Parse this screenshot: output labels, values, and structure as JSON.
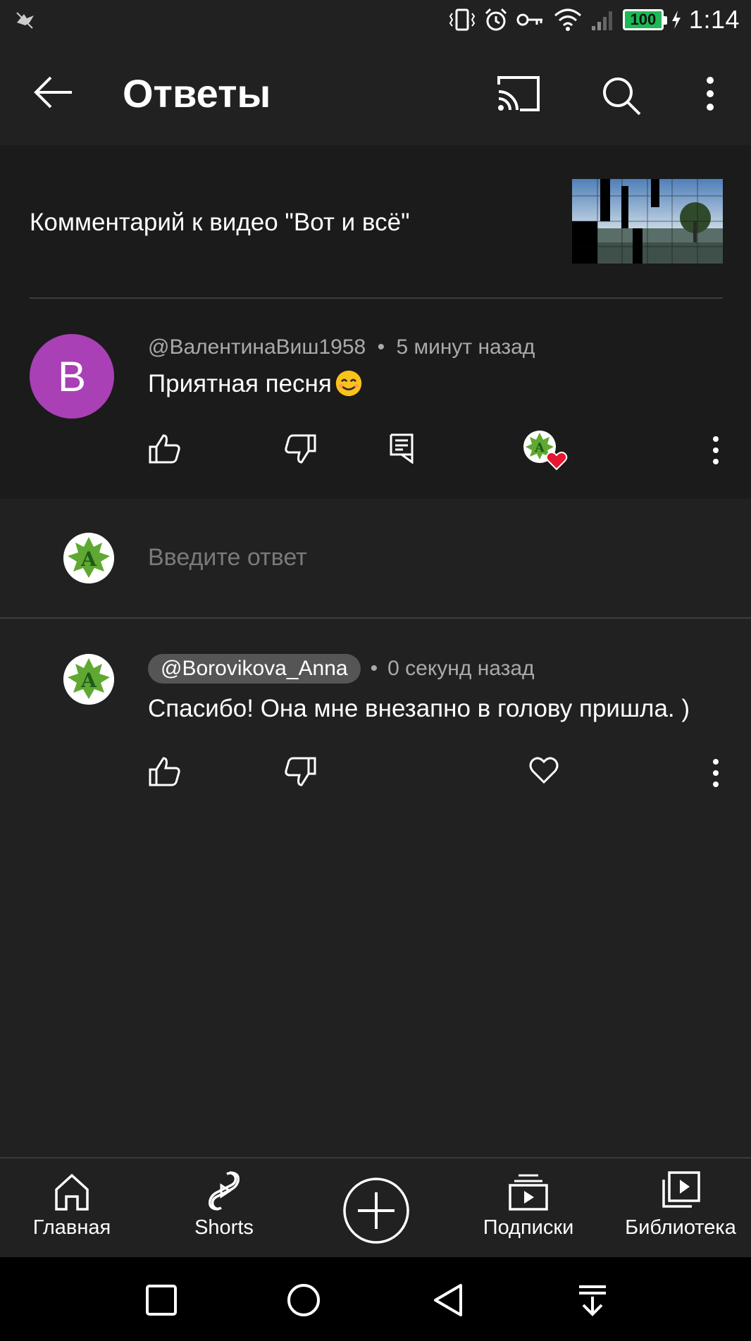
{
  "status_bar": {
    "battery": "100",
    "time": "1:14"
  },
  "header": {
    "title": "Ответы",
    "icons": [
      "back-arrow-icon",
      "cast-icon",
      "search-icon",
      "more-vert-icon"
    ]
  },
  "video": {
    "label": "Комментарий к видео \"Вот и всё\""
  },
  "comment": {
    "avatar_letter": "В",
    "author": "@ВалентинаВиш1958",
    "separator": "•",
    "time": "5 минут назад",
    "text": "Приятная песня"
  },
  "reply_input": {
    "placeholder": "Введите ответ"
  },
  "reply": {
    "author": "@Borovikova_Anna",
    "separator": "•",
    "time": "0 секунд назад",
    "text": "Спасибо! Она мне внезапно в голову пришла. )"
  },
  "bottom_nav": {
    "items": [
      {
        "label": "Главная",
        "icon": "home-icon"
      },
      {
        "label": "Shorts",
        "icon": "shorts-icon"
      },
      {
        "label": "",
        "icon": "create-plus-icon"
      },
      {
        "label": "Подписки",
        "icon": "subscriptions-icon"
      },
      {
        "label": "Библиотека",
        "icon": "library-icon"
      }
    ]
  },
  "colors": {
    "background": "#212121",
    "panel": "#1b1b1b",
    "avatar_purple": "#a940b6",
    "heart_red": "#e8162e",
    "battery_green": "#1db954"
  }
}
